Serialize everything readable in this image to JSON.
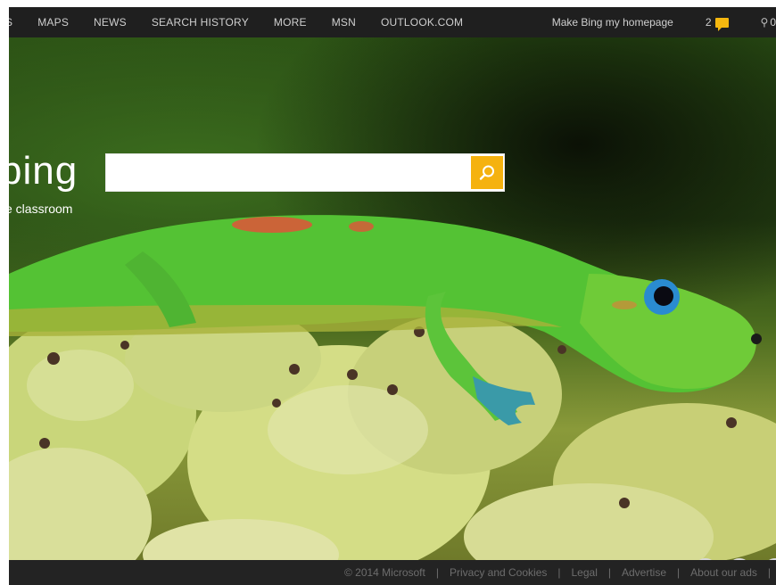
{
  "topnav": {
    "items": [
      {
        "label": "S"
      },
      {
        "label": "MAPS"
      },
      {
        "label": "NEWS"
      },
      {
        "label": "SEARCH HISTORY"
      },
      {
        "label": "MORE"
      },
      {
        "label": "MSN"
      },
      {
        "label": "OUTLOOK.COM"
      }
    ],
    "homepage_label": "Make Bing my homepage",
    "notification_count": "2",
    "rewards_count": "0"
  },
  "search": {
    "logo_text": "bing",
    "caption": "e classroom",
    "query": "",
    "accent_color": "#f5b20f"
  },
  "icons": {
    "notification": "message-icon",
    "rewards": "trophy-icon",
    "search": "search-icon",
    "prev": "chevron-left-icon",
    "next": "chevron-right-icon"
  },
  "footer": {
    "copyright": "© 2014 Microsoft",
    "links": [
      "Privacy and Cookies",
      "Legal",
      "Advertise",
      "About our ads"
    ]
  }
}
